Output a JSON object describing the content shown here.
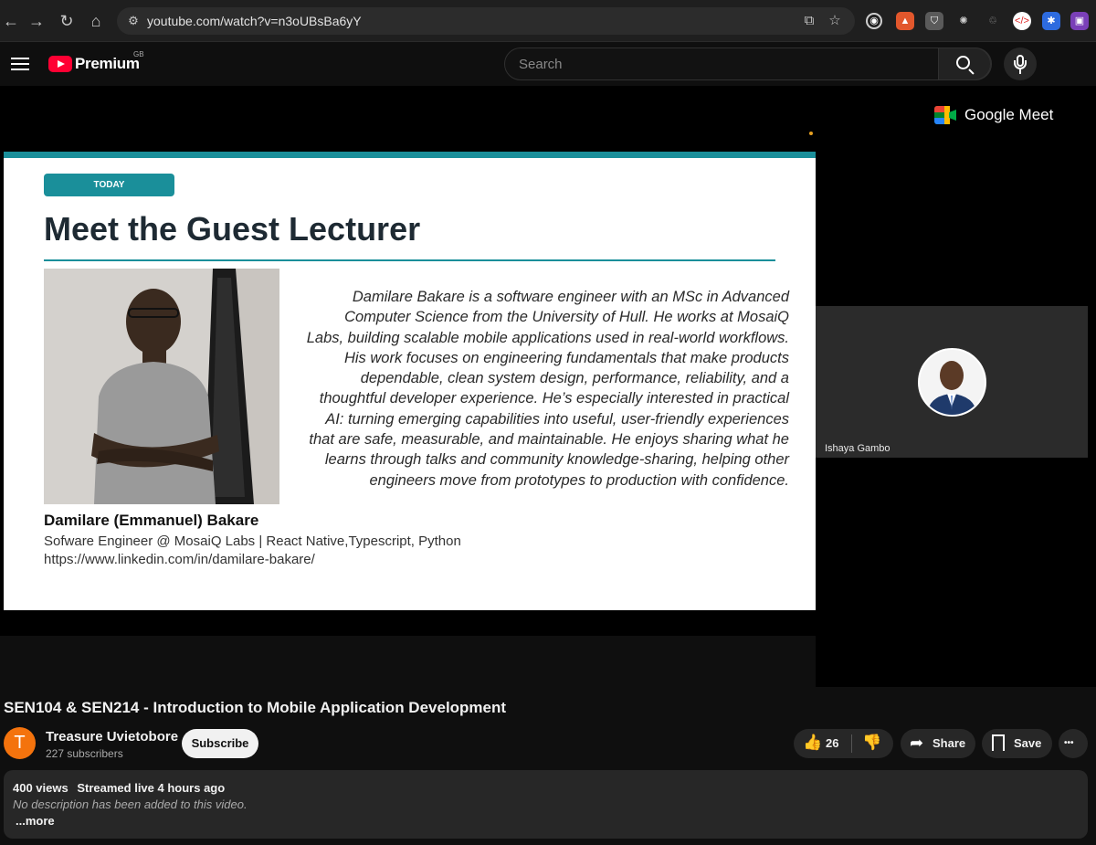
{
  "browser": {
    "url": "youtube.com/watch?v=n3oUBsBa6yY",
    "nav_icons": [
      "back-icon",
      "forward-icon",
      "reload-icon",
      "home-icon"
    ],
    "extension_icons": [
      "target-icon",
      "fox-icon",
      "shield-icon",
      "atom-icon",
      "recycle-icon",
      "code-icon",
      "gear-badge-icon",
      "puzzle-icon"
    ]
  },
  "header": {
    "logo_text": "Premium",
    "country": "GB",
    "search_placeholder": "Search",
    "brand_color": "#ff0033"
  },
  "slide": {
    "badge": "TODAY",
    "heading": "Meet the Guest Lecturer",
    "bio": "Damilare Bakare is a software engineer with an MSc in Advanced Computer Science from the University of Hull. He works at MosaiQ Labs, building scalable mobile applications used in real-world workflows. His work focuses on engineering fundamentals that make products dependable, clean system design, performance, reliability, and a thoughtful developer experience. He’s especially interested in practical AI: turning emerging capabilities into useful, user-friendly experiences that are safe, measurable, and maintainable. He enjoys sharing what he learns through talks and community knowledge-sharing, helping other engineers move from prototypes to production with confidence.",
    "name": "Damilare (Emmanuel) Bakare",
    "role": "Sofware Engineer @ MosaiQ Labs | React Native,Typescript, Python",
    "link": "https://www.linkedin.com/in/damilare-bakare/",
    "accent_color": "#1a8f9a"
  },
  "meet": {
    "logo_label": "Google Meet",
    "participant_name": "Ishaya Gambo"
  },
  "video": {
    "title": "SEN104 & SEN214 - Introduction to Mobile Application Development",
    "channel_initial": "T",
    "channel_name": "Treasure Uvietobore",
    "subscribers": "227 subscribers",
    "subscribe_label": "Subscribe",
    "likes": "26",
    "share_label": "Share",
    "save_label": "Save",
    "more_glyph": "•••",
    "views": "400 views",
    "streamed": "Streamed live 4 hours ago",
    "description": "No description has been added to this video.",
    "more_label": "...more"
  }
}
